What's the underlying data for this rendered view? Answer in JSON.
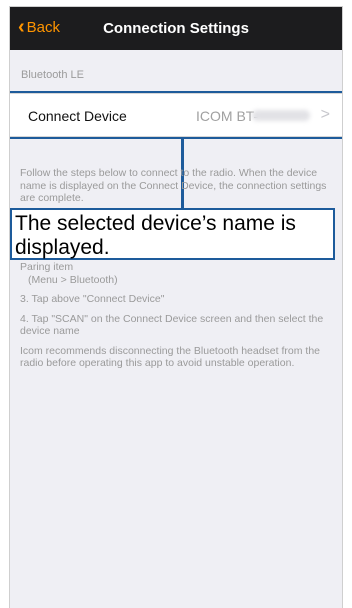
{
  "navbar": {
    "back_label": "Back",
    "title": "Connection Settings"
  },
  "section": {
    "header": "Bluetooth LE"
  },
  "connect_cell": {
    "label": "Connect Device",
    "value": "ICOM BT-",
    "chevron": ">"
  },
  "instructions": {
    "intro": "Follow the steps below to connect to the radio. When the device name is displayed on the Connect Device, the connection settings are complete.",
    "step2": "2. Turn ON the Bluetooth function and then select the Waiting Paring item",
    "step2_menu": "(Menu > Bluetooth)",
    "step3": "3. Tap above \"Connect Device\"",
    "step4": "4. Tap \"SCAN\" on the Connect Device screen and then select the device name",
    "note": "Icom recommends disconnecting the Bluetooth headset from the radio before operating this app to avoid unstable operation."
  },
  "callout": {
    "text": "The selected device’s name is displayed."
  },
  "colors": {
    "accent": "#ff9500",
    "navbar_bg": "#1c1c1e",
    "callout_border": "#1d5b9b",
    "background": "#efeff4"
  }
}
